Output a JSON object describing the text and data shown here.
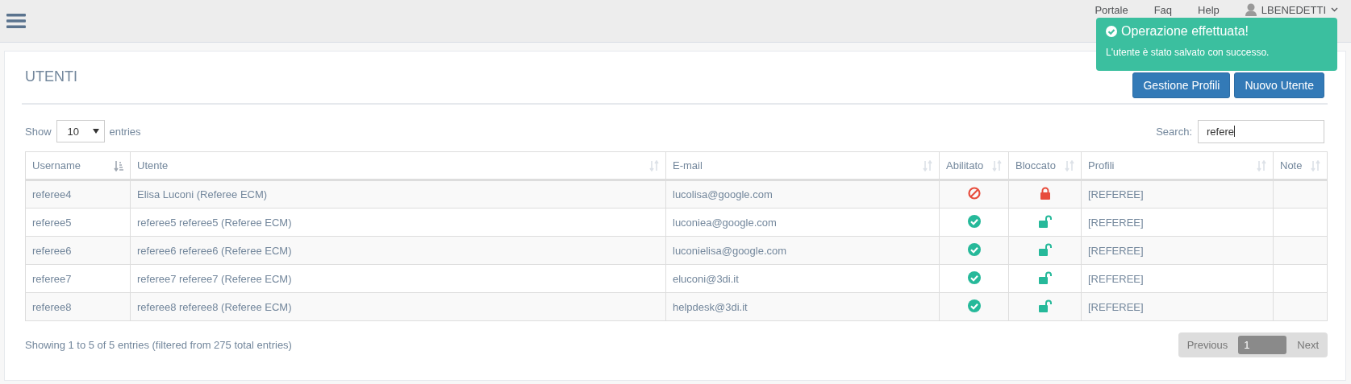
{
  "header": {
    "nav": [
      "Portale",
      "Faq",
      "Help"
    ],
    "user": "LBENEDETTI"
  },
  "toast": {
    "title": "Operazione effettuata!",
    "message": "L'utente è stato salvato con successo."
  },
  "panel": {
    "title": "UTENTI",
    "buttons": [
      "Gestione Profili",
      "Nuovo Utente"
    ]
  },
  "length": {
    "label_before": "Show",
    "value": "10",
    "label_after": "entries"
  },
  "search": {
    "label": "Search:",
    "value": "refere"
  },
  "table": {
    "columns": [
      {
        "label": "Username",
        "sorted": true
      },
      {
        "label": "Utente",
        "sorted": false
      },
      {
        "label": "E-mail",
        "sorted": false
      },
      {
        "label": "Abilitato",
        "sorted": false
      },
      {
        "label": "Bloccato",
        "sorted": false
      },
      {
        "label": "Profili",
        "sorted": false
      },
      {
        "label": "Note",
        "sorted": false
      }
    ],
    "rows": [
      {
        "username": "referee4",
        "utente": "Elisa Luconi (Referee ECM)",
        "email": "lucolisa@google.com",
        "abilitato": false,
        "bloccato": true,
        "profili": "[REFEREE]"
      },
      {
        "username": "referee5",
        "utente": "referee5 referee5 (Referee ECM)",
        "email": "luconiea@google.com",
        "abilitato": true,
        "bloccato": false,
        "profili": "[REFEREE]"
      },
      {
        "username": "referee6",
        "utente": "referee6 referee6 (Referee ECM)",
        "email": "luconielisa@google.com",
        "abilitato": true,
        "bloccato": false,
        "profili": "[REFEREE]"
      },
      {
        "username": "referee7",
        "utente": "referee7 referee7 (Referee ECM)",
        "email": "eluconi@3di.it",
        "abilitato": true,
        "bloccato": false,
        "profili": "[REFEREE]"
      },
      {
        "username": "referee8",
        "utente": "referee8 referee8 (Referee ECM)",
        "email": "helpdesk@3di.it",
        "abilitato": true,
        "bloccato": false,
        "profili": "[REFEREE]"
      }
    ]
  },
  "info": "Showing 1 to 5 of 5 entries (filtered from 275 total entries)",
  "pagination": [
    {
      "label": "Previous",
      "selected": false
    },
    {
      "label": "1",
      "selected": true
    },
    {
      "label": "Next",
      "selected": false
    }
  ]
}
